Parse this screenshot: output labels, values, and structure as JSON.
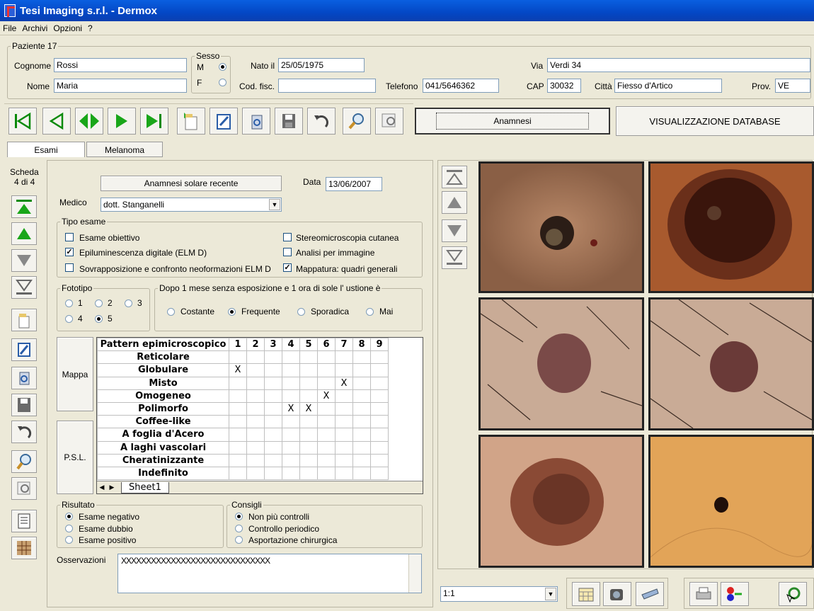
{
  "window": {
    "title": "Tesi Imaging s.r.l. - Dermox"
  },
  "menu": [
    "File",
    "Archivi",
    "Opzioni",
    "?"
  ],
  "patient": {
    "group_label": "Paziente 17",
    "surname_label": "Cognome",
    "surname": "Rossi",
    "name_label": "Nome",
    "name": "Maria",
    "sex_label": "Sesso",
    "sex_m": "M",
    "sex_f": "F",
    "sex_selected": "M",
    "born_label": "Nato il",
    "born": "25/05/1975",
    "cf_label": "Cod. fisc.",
    "cf": "",
    "phone_label": "Telefono",
    "phone": "041/5646362",
    "street_label": "Via",
    "street": "Verdi 34",
    "cap_label": "CAP",
    "cap": "30032",
    "city_label": "Città",
    "city": "Fiesso d'Artico",
    "prov_label": "Prov.",
    "prov": "VE"
  },
  "toolbar": {
    "icons": [
      "first-record-icon",
      "previous-record-icon",
      "navigate-both-icon",
      "next-record-icon",
      "last-record-icon",
      "new-record-icon",
      "edit-record-icon",
      "delete-record-icon",
      "save-icon",
      "undo-icon",
      "search-icon",
      "zoom-preview-icon"
    ],
    "anamnesi_button": "Anamnesi",
    "db_view_button": "VISUALIZZAZIONE DATABASE"
  },
  "tabs": [
    {
      "label": "Esami",
      "active": true
    },
    {
      "label": "Melanoma",
      "active": false
    }
  ],
  "card": {
    "label": "Scheda",
    "position": "4 di 4"
  },
  "exam": {
    "recent_sun_button": "Anamnesi solare recente",
    "date_label": "Data",
    "date": "13/06/2007",
    "doctor_label": "Medico",
    "doctor": "dott. Stanganelli",
    "type_group": "Tipo esame",
    "types": [
      {
        "label": "Esame obiettivo",
        "checked": false
      },
      {
        "label": "Epiluminescenza digitale (ELM D)",
        "checked": true
      },
      {
        "label": "Sovrapposizione e confronto neoformazioni ELM D",
        "checked": false
      },
      {
        "label": "Stereomicroscopia cutanea",
        "checked": false
      },
      {
        "label": "Analisi per immagine",
        "checked": false
      },
      {
        "label": "Mappatura: quadri generali",
        "checked": true
      }
    ],
    "phototype_group": "Fototipo",
    "phototypes": [
      "1",
      "2",
      "3",
      "4",
      "5"
    ],
    "phototype_selected": "5",
    "burn_group": "Dopo 1 mese senza esposizione e 1 ora di sole l' ustione è",
    "burn_options": [
      "Costante",
      "Frequente",
      "Sporadica",
      "Mai"
    ],
    "burn_selected": "Frequente",
    "map_button": "Mappa",
    "psl_button": "P.S.L.",
    "pattern": {
      "header": "Pattern epimicroscopico",
      "columns": [
        "1",
        "2",
        "3",
        "4",
        "5",
        "6",
        "7",
        "8",
        "9"
      ],
      "rows": [
        {
          "label": "Reticolare",
          "marks": [
            "",
            "",
            "",
            "",
            "",
            "",
            "",
            "",
            ""
          ]
        },
        {
          "label": "Globulare",
          "marks": [
            "X",
            "",
            "",
            "",
            "",
            "",
            "",
            "",
            ""
          ]
        },
        {
          "label": "Misto",
          "marks": [
            "",
            "",
            "",
            "",
            "",
            "",
            "X",
            "",
            ""
          ]
        },
        {
          "label": "Omogeneo",
          "marks": [
            "",
            "",
            "",
            "",
            "",
            "X",
            "",
            "",
            ""
          ]
        },
        {
          "label": "Polimorfo",
          "marks": [
            "",
            "",
            "",
            "X",
            "X",
            "",
            "",
            "",
            ""
          ]
        },
        {
          "label": "Coffee-like",
          "marks": [
            "",
            "",
            "",
            "",
            "",
            "",
            "",
            "",
            ""
          ]
        },
        {
          "label": "A foglia d'Acero",
          "marks": [
            "",
            "",
            "",
            "",
            "",
            "",
            "",
            "",
            ""
          ]
        },
        {
          "label": "A laghi vascolari",
          "marks": [
            "",
            "",
            "",
            "",
            "",
            "",
            "",
            "",
            ""
          ]
        },
        {
          "label": "Cheratinizzante",
          "marks": [
            "",
            "",
            "",
            "",
            "",
            "",
            "",
            "",
            ""
          ]
        },
        {
          "label": "Indefinito",
          "marks": [
            "",
            "",
            "",
            "",
            "",
            "",
            "",
            "",
            ""
          ]
        }
      ],
      "sheet_tab": "Sheet1"
    },
    "result_group": "Risultato",
    "results": [
      "Esame negativo",
      "Esame dubbio",
      "Esame positivo"
    ],
    "result_selected": "Esame negativo",
    "advice_group": "Consigli",
    "advice": [
      "Non più controlli",
      "Controllo periodico",
      "Asportazione chirurgica"
    ],
    "advice_selected": "Non più controlli",
    "notes_label": "Osservazioni",
    "notes": "XXXXXXXXXXXXXXXXXXXXXXXXXXXXXX"
  },
  "images": {
    "zoom": "1:1",
    "colors": {
      "skin_dark": "#8a5a3c",
      "skin_light": "#c9a58a",
      "lesion": "#3a1d14"
    }
  },
  "colors": {
    "titlebar": "#0347c5",
    "nav_green": "#19a619"
  }
}
